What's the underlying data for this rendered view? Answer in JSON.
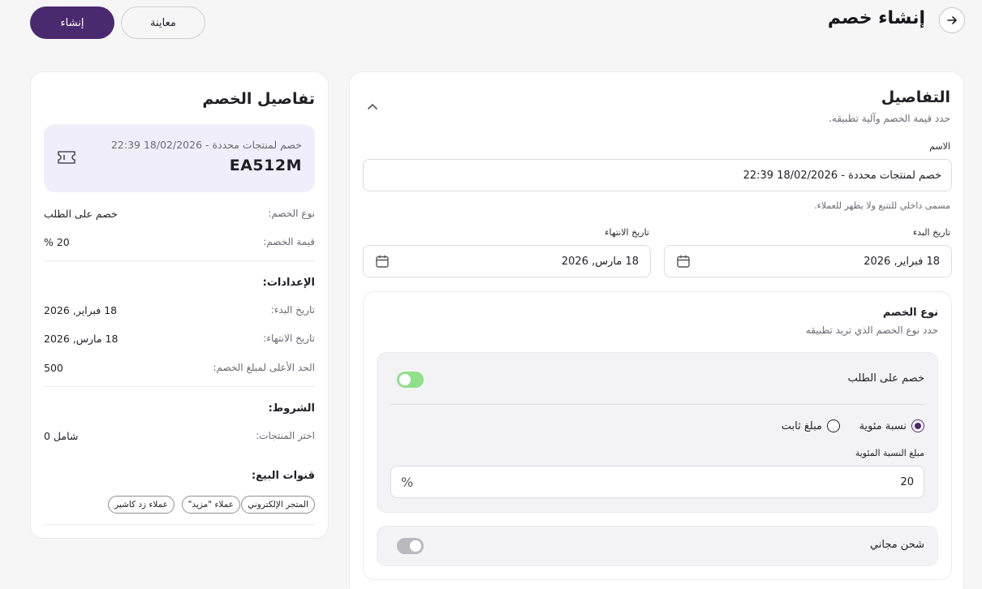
{
  "header": {
    "title": "إنشاء خصم",
    "create_label": "إنشاء",
    "preview_label": "معاينة"
  },
  "details": {
    "title": "التفاصيل",
    "subtitle": "حدد قيمة الخصم وآلية تطبيقه.",
    "name_label": "الاسم",
    "name_value": "خصم لمنتجات محددة - 18/02/2026 22:39",
    "name_hint": "مسمى داخلي للتتبع ولا يظهر للعملاء.",
    "start_label": "تاريخ البدء",
    "start_value": "18 فبراير, 2026",
    "end_label": "تاريخ الانتهاء",
    "end_value": "18 مارس, 2026"
  },
  "discount_type": {
    "title": "نوع الخصم",
    "subtitle": "حدد نوع الخصم الذي تريد تطبيقه",
    "order_discount_label": "خصم على الطلب",
    "order_discount_enabled": true,
    "option_percentage": "نسبة مئوية",
    "option_fixed": "مبلغ ثابت",
    "selected_option": "percentage",
    "percentage_label": "مبلغ النسبة المئوية",
    "percentage_value": "20",
    "percent_symbol": "%",
    "free_shipping_label": "شحن مجاني",
    "free_shipping_enabled": false
  },
  "summary": {
    "title": "تفاصيل الخصم",
    "coupon_name": "خصم لمنتجات محددة - 18/02/2026 22:39",
    "coupon_code": "EA512M",
    "type_label": "نوع الخصم:",
    "type_value": "خصم على الطلب",
    "value_label": "قيمة الخصم:",
    "value_value": "20 %",
    "settings_head": "الإعدادات:",
    "start_label": "تاريخ البدء:",
    "start_value": "18 فبراير, 2026",
    "end_label": "تاريخ الانتهاء:",
    "end_value": "18 مارس, 2026",
    "max_label": "الحد الأعلى لمبلغ الخصم:",
    "max_value": "500",
    "conditions_head": "الشروط:",
    "products_label": "اختر المنتجات:",
    "products_value": "شامل 0",
    "channels_head": "قنوات البيع:",
    "channels": [
      "المتجر الإلكتروني",
      "عملاء \"مزيد\"",
      "عملاء زد كاشير"
    ]
  },
  "colors": {
    "primary": "#4a2a6e",
    "toggle_on": "#90e08a",
    "coupon_bg": "#f1eefb"
  }
}
